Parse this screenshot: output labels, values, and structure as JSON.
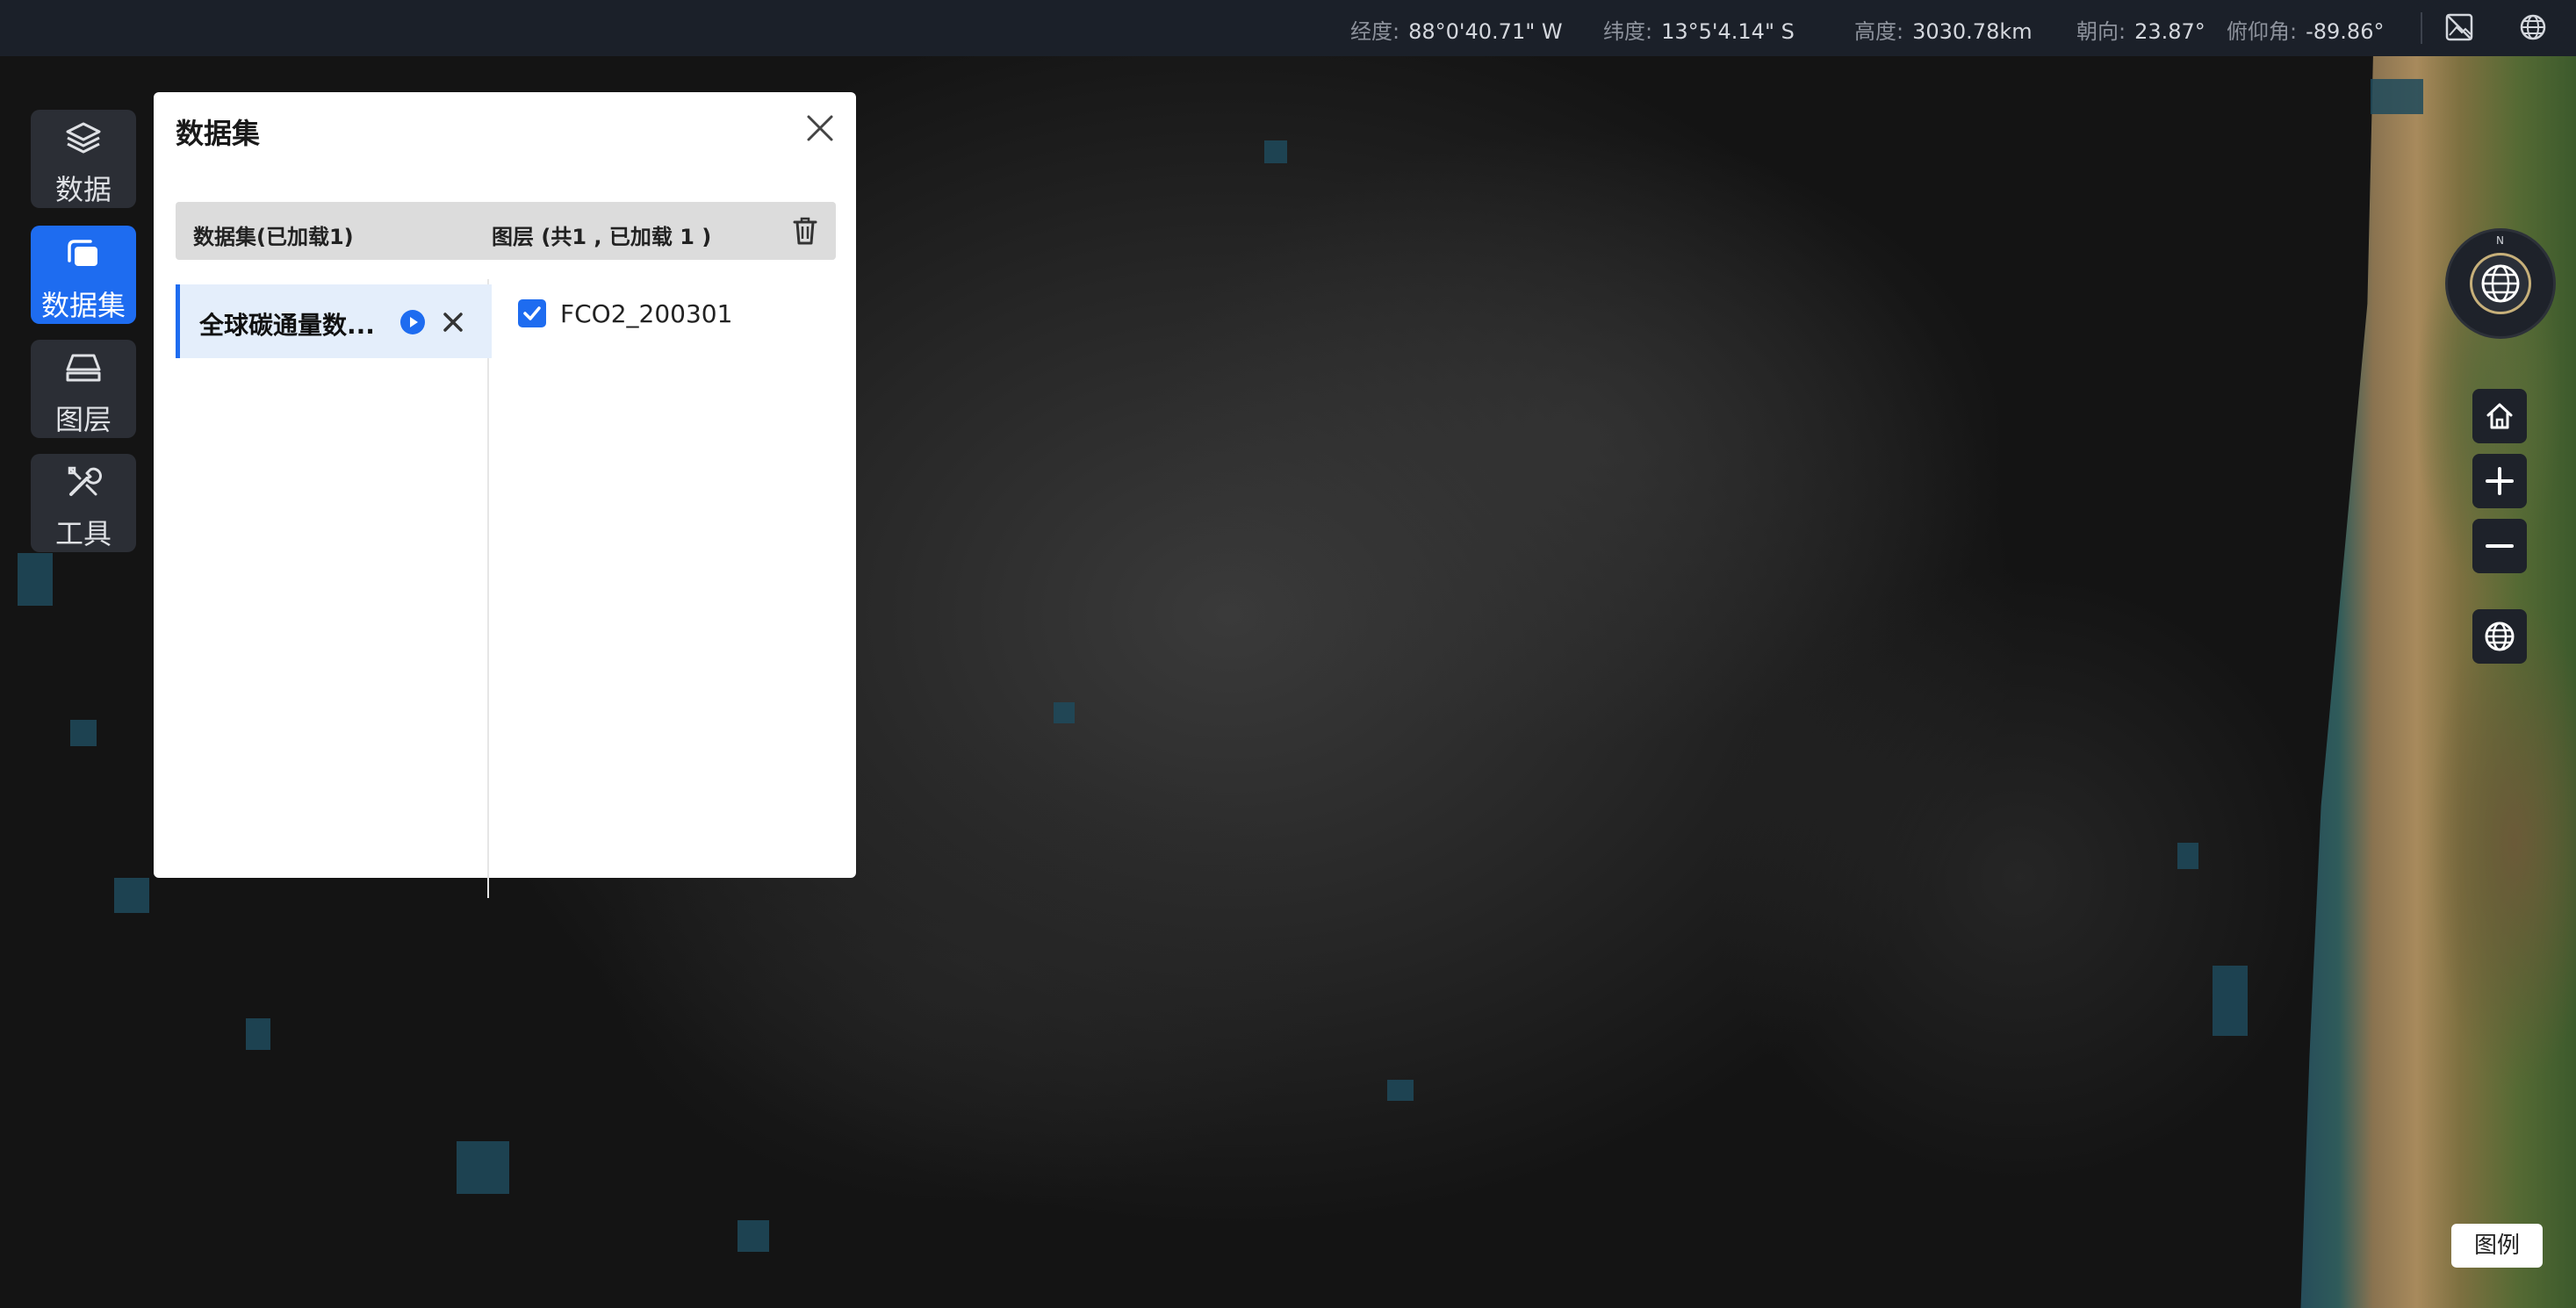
{
  "status_bar": {
    "longitude_label": "经度:",
    "longitude_value": "88°0'40.71\" W",
    "latitude_label": "纬度:",
    "latitude_value": "13°5'4.14\" S",
    "altitude_label": "高度:",
    "altitude_value": "3030.78km",
    "heading_label": "朝向:",
    "heading_value": "23.87°",
    "pitch_label": "俯仰角:",
    "pitch_value": "-89.86°",
    "icons": [
      "no-image-icon",
      "globe-language-icon"
    ]
  },
  "sidebar": {
    "items": [
      {
        "label": "数据",
        "icon": "layers-stack-icon",
        "active": false
      },
      {
        "label": "数据集",
        "icon": "dataset-icon",
        "active": true
      },
      {
        "label": "图层",
        "icon": "layer-plane-icon",
        "active": false
      },
      {
        "label": "工具",
        "icon": "tools-icon",
        "active": false
      }
    ]
  },
  "dataset_panel": {
    "title": "数据集",
    "header_datasets": "数据集(已加载1)",
    "header_layers": "图层 (共1 , 已加载 1 )",
    "datasets": [
      {
        "name": "全球碳通量数...",
        "selected": true
      }
    ],
    "layers": [
      {
        "name": "FCO2_200301",
        "checked": true
      }
    ]
  },
  "map_controls": {
    "compass_north": "N",
    "legend_label": "图例"
  },
  "colors": {
    "accent": "#1e6cf0",
    "topbar_bg": "#1b2029",
    "sidebar_bg": "#2b2e35",
    "panel_header_bg": "#dcdcdc",
    "selected_item_bg": "#e4eefb"
  }
}
